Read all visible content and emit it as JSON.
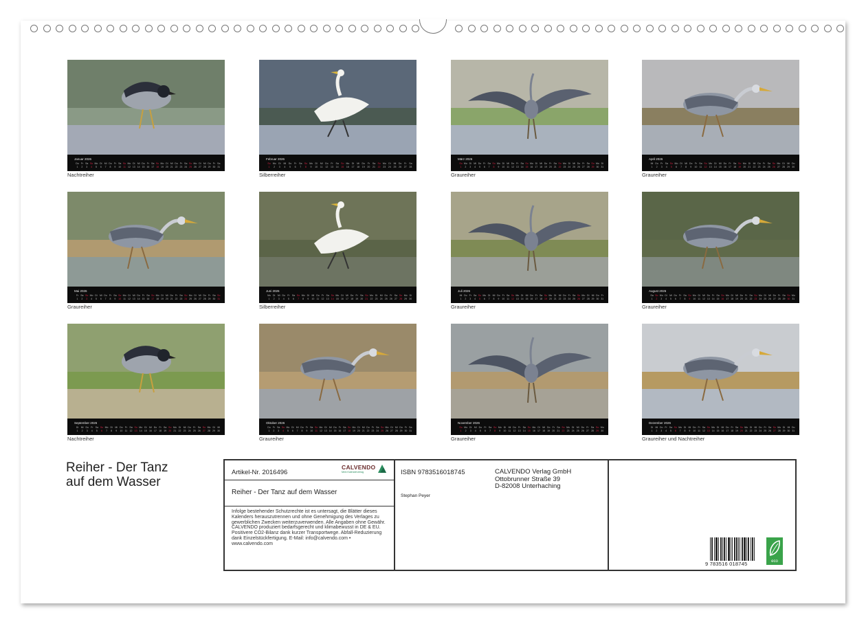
{
  "months": [
    {
      "label": "Januar 2026",
      "caption": "Nachtreiher",
      "days": 31,
      "sundays": [
        4,
        11,
        18,
        25
      ]
    },
    {
      "label": "Februar 2026",
      "caption": "Silberreiher",
      "days": 28,
      "sundays": [
        1,
        8,
        15,
        22
      ]
    },
    {
      "label": "März 2026",
      "caption": "Graureiher",
      "days": 31,
      "sundays": [
        1,
        8,
        15,
        22,
        29
      ]
    },
    {
      "label": "April 2026",
      "caption": "Graureiher",
      "days": 30,
      "sundays": [
        5,
        12,
        19,
        26
      ]
    },
    {
      "label": "Mai 2026",
      "caption": "Graureiher",
      "days": 31,
      "sundays": [
        3,
        10,
        17,
        24,
        31
      ]
    },
    {
      "label": "Juni 2026",
      "caption": "Silberreiher",
      "days": 30,
      "sundays": [
        7,
        14,
        21,
        28
      ]
    },
    {
      "label": "Juli 2026",
      "caption": "Graureiher",
      "days": 31,
      "sundays": [
        5,
        12,
        19,
        26
      ]
    },
    {
      "label": "August 2026",
      "caption": "Graureiher",
      "days": 31,
      "sundays": [
        2,
        9,
        16,
        23,
        30
      ]
    },
    {
      "label": "September 2026",
      "caption": "Nachtreiher",
      "days": 30,
      "sundays": [
        6,
        13,
        20,
        27
      ]
    },
    {
      "label": "Oktober 2026",
      "caption": "Graureiher",
      "days": 31,
      "sundays": [
        4,
        11,
        18,
        25
      ]
    },
    {
      "label": "November 2026",
      "caption": "Graureiher",
      "days": 30,
      "sundays": [
        1,
        8,
        15,
        22,
        29
      ]
    },
    {
      "label": "Dezember 2026",
      "caption": "Graureiher und Nachtreiher",
      "days": 31,
      "sundays": [
        6,
        13,
        20,
        27
      ]
    }
  ],
  "title_line1": "Reiher - Der Tanz",
  "title_line2": "auf dem Wasser",
  "info": {
    "article_number": "Artikel-Nr. 2016496",
    "brand": "CALVENDO",
    "brand_tagline": "Mein Kalenderverlag",
    "book_title": "Reiher - Der Tanz auf dem Wasser",
    "legal_text": "Infolge bestehender Schutzrechte ist es untersagt, die Blätter dieses Kalenders herauszutrennen und ohne Genehmigung des Verlages zu gewerblichen Zwecken weiterzuverwenden. Alle Angaben ohne Gewähr. CALVENDO produziert bedarfsgerecht und klimabewusst in DE & EU. Positivere CO2-Bilanz dank kurzer Transportwege. Abfall-Reduzierung dank Einzelstückfertigung. E-Mail: info@calvendo.com • www.calvendo.com",
    "isbn": "ISBN 9783516018745",
    "author": "Stephan Peyer",
    "publisher_name": "CALVENDO Verlag GmbH",
    "publisher_street": "Ottobrunner Straße 39",
    "publisher_city": "D-82008 Unterhaching",
    "barcode_digits": "9 783516 018745",
    "eco_label": "eco"
  },
  "colors": {
    "calendar_bar": "#0c0c0c",
    "sunday": "#d22244",
    "eco_green": "#3aa34a"
  }
}
